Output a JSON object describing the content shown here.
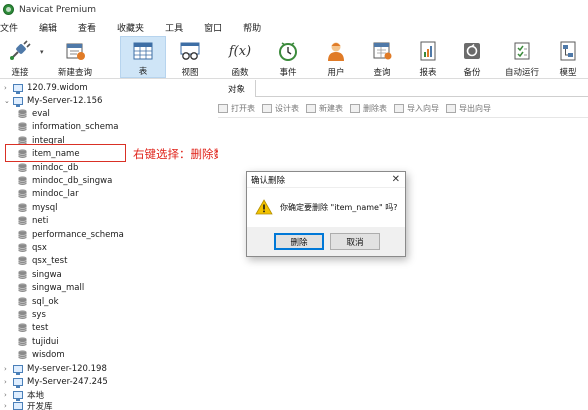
{
  "app": {
    "title": "Navicat Premium"
  },
  "menu": [
    "文件",
    "编辑",
    "查看",
    "收藏夹",
    "工具",
    "窗口",
    "帮助"
  ],
  "toolbar": {
    "connect": "连接",
    "new_query": "新建查询",
    "table": "表",
    "view": "视图",
    "function": "函数",
    "event": "事件",
    "user": "用户",
    "query": "查询",
    "report": "报表",
    "backup": "备份",
    "autorun": "自动运行",
    "model": "模型",
    "function_glyph": "f(x)"
  },
  "tree": {
    "conn1": "120.79.widom",
    "conn2": "My-Server-12.156",
    "dbs": [
      "eval",
      "information_schema",
      "integral",
      "item_name",
      "mindoc_db",
      "mindoc_db_singwa",
      "mindoc_lar",
      "mysql",
      "neti",
      "performance_schema",
      "qsx",
      "qsx_test",
      "singwa",
      "singwa_mall",
      "sql_ok",
      "sys",
      "test",
      "tujidui",
      "wisdom"
    ],
    "conn3": "My-server-120.198",
    "conn4": "My-Server-247.245",
    "conn5": "本地",
    "conn6": "开发库"
  },
  "annotation": "右键选择：删除数据库",
  "objects_tab": "对象",
  "object_toolbar": [
    "打开表",
    "设计表",
    "新建表",
    "删除表",
    "导入向导",
    "导出向导"
  ],
  "dialog": {
    "title": "确认删除",
    "message": "你确定要删除 \"item_name\" 吗?",
    "delete_label": "删除",
    "cancel_label": "取消",
    "close_glyph": "✕"
  },
  "colors": {
    "accent": "#cfe5f7",
    "annotation": "#e0241b",
    "db_icon": "#8a8a8a",
    "warning": "#f2c200"
  }
}
